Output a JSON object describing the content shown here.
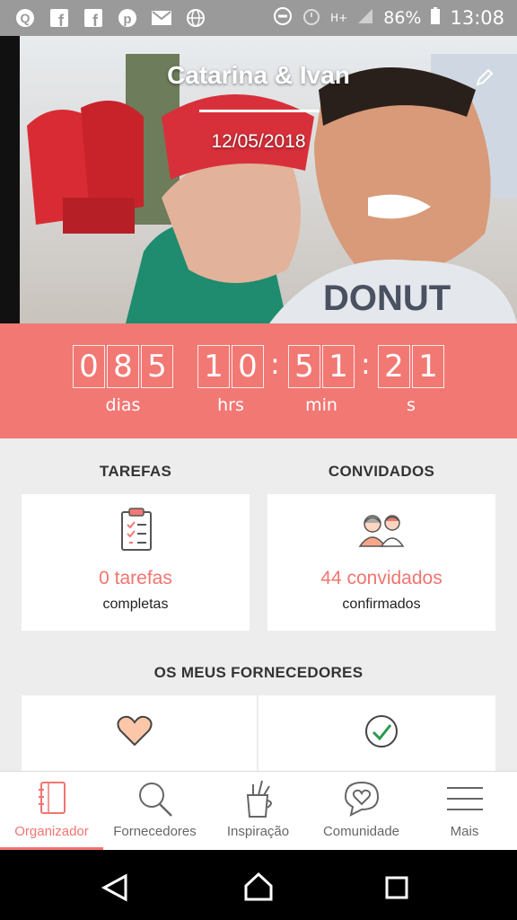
{
  "status_bar": {
    "battery": "86%",
    "time": "13:08",
    "network": "H+",
    "icons": [
      "app-icon",
      "facebook-icon",
      "facebook-icon",
      "pinterest-icon",
      "gmail-icon",
      "globe-icon",
      "do-not-disturb-icon",
      "alarm-icon",
      "signal-icon",
      "battery-icon"
    ]
  },
  "hero": {
    "title": "Catarina & Ivan",
    "date": "12/05/2018",
    "edit_icon": "edit-icon"
  },
  "countdown": {
    "days_digits": [
      "0",
      "8",
      "5"
    ],
    "hours_digits": [
      "1",
      "0"
    ],
    "minutes_digits": [
      "5",
      "1"
    ],
    "seconds_digits": [
      "2",
      "1"
    ],
    "separator": ":",
    "labels": {
      "days": "dias",
      "hours": "hrs",
      "minutes": "min",
      "seconds": "s"
    }
  },
  "cards": {
    "tasks": {
      "heading": "TAREFAS",
      "value": "0 tarefas",
      "sub": "completas",
      "icon": "clipboard-checklist-icon"
    },
    "guests": {
      "heading": "CONVIDADOS",
      "value": "44 convidados",
      "sub": "confirmados",
      "icon": "guests-icon"
    }
  },
  "vendors": {
    "heading": "OS MEUS FORNECEDORES",
    "icons": [
      "heart-icon",
      "check-circle-icon"
    ]
  },
  "tabs": [
    {
      "label": "Organizador",
      "icon": "notebook-icon",
      "active": true
    },
    {
      "label": "Fornecedores",
      "icon": "search-icon",
      "active": false
    },
    {
      "label": "Inspiração",
      "icon": "pencil-cup-icon",
      "active": false
    },
    {
      "label": "Comunidade",
      "icon": "heart-chat-icon",
      "active": false
    },
    {
      "label": "Mais",
      "icon": "menu-icon",
      "active": false
    }
  ],
  "colors": {
    "accent": "#f27874",
    "status_bar": "#9a9a9a",
    "background": "#ededed"
  }
}
